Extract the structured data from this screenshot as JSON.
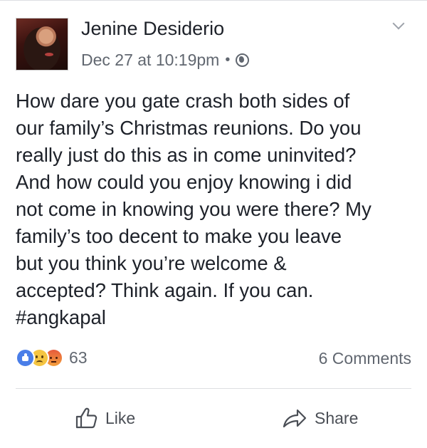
{
  "post": {
    "author": "Jenine Desiderio",
    "timestamp": "Dec 27 at 10:19pm",
    "separator": "•",
    "privacy_icon": "globe-icon",
    "text_lines": [
      "How dare you gate crash both sides of",
      "our family’s Christmas reunions. Do you",
      "really just do this as in come uninvited?",
      "And how could you enjoy knowing i did",
      "not come in knowing you were there? My",
      "family’s too decent to make you leave",
      "but you think you’re welcome &",
      "accepted? Think again. If you can.",
      "#angkapal"
    ],
    "reactions": {
      "icons": [
        "like-reaction-icon",
        "sad-reaction-icon",
        "angry-reaction-icon"
      ],
      "count": "63"
    },
    "comments": "6 Comments"
  },
  "actions": {
    "like": "Like",
    "share": "Share"
  },
  "colors": {
    "text": "#1d2129",
    "meta": "#616770",
    "like_blue": "#4a7ee8",
    "divider": "#dddfe2"
  }
}
